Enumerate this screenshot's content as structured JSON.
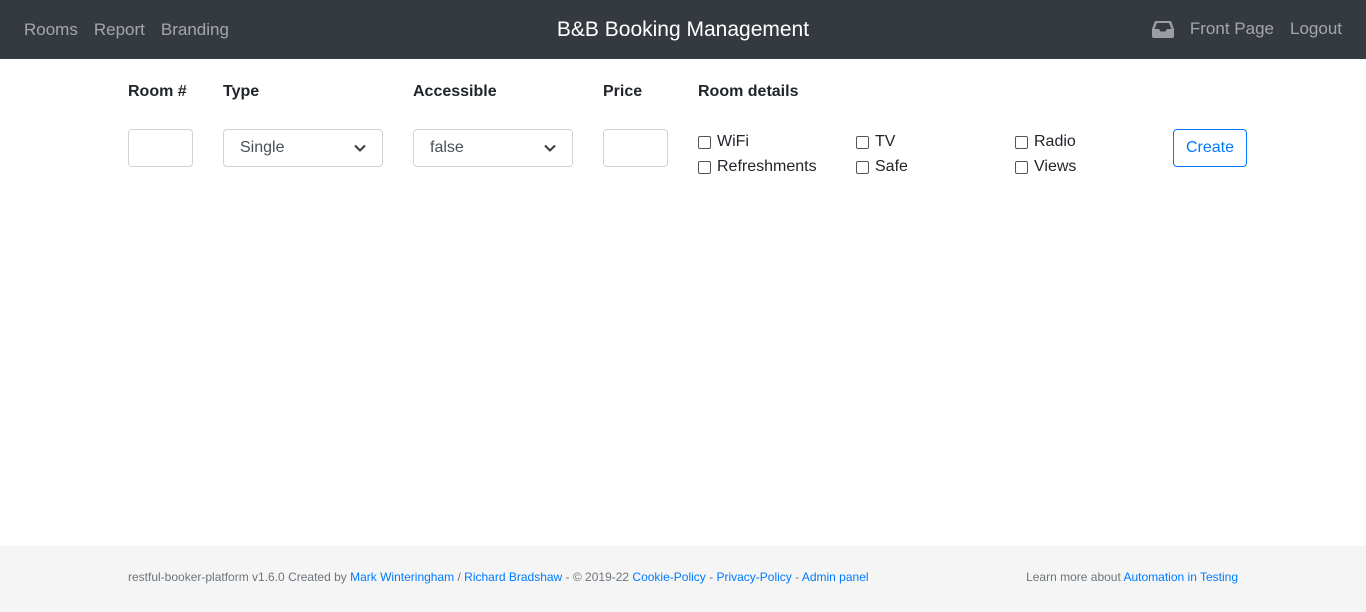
{
  "nav": {
    "links": [
      "Rooms",
      "Report",
      "Branding"
    ],
    "brand": "B&B Booking Management",
    "front_page": "Front Page",
    "logout": "Logout"
  },
  "form": {
    "headers": {
      "room": "Room #",
      "type": "Type",
      "accessible": "Accessible",
      "price": "Price",
      "details": "Room details"
    },
    "room_value": "",
    "type_value": "Single",
    "accessible_value": "false",
    "price_value": "",
    "checkboxes": [
      "WiFi",
      "Refreshments",
      "TV",
      "Safe",
      "Radio",
      "Views"
    ],
    "create_label": "Create"
  },
  "footer": {
    "prefix": "restful-booker-platform v1.6.0 Created by ",
    "author1": "Mark Winteringham",
    "sep1": " / ",
    "author2": "Richard Bradshaw",
    "copyright": " - © 2019-22 ",
    "cookie": "Cookie-Policy",
    "dash1": " - ",
    "privacy": "Privacy-Policy",
    "dash2": " - ",
    "admin": "Admin panel",
    "learn_prefix": "Learn more about ",
    "learn_link": "Automation in Testing"
  },
  "colors": {
    "navbar": "#343a40",
    "accent": "#007bff",
    "footer_bg": "#f5f5f5"
  },
  "icons": {
    "inbox": "inbox-icon",
    "chevron": "chevron-down-icon"
  }
}
